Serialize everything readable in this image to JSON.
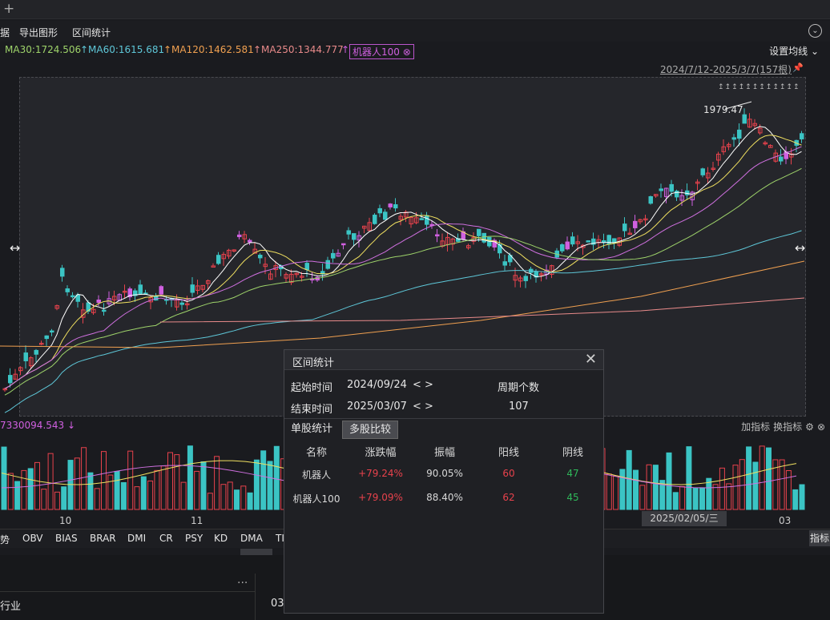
{
  "menu": {
    "items": [
      "据",
      "导出图形",
      "区间统计"
    ],
    "settings_icon": "circle-chevron-down-icon"
  },
  "ma": {
    "ma30": "MA30:1724.506",
    "ma60": "MA60:1615.681",
    "ma120": "MA120:1462.581",
    "ma250": "MA250:1344.777",
    "tag": "机器人100"
  },
  "setma": "设置均线",
  "range": "2024/7/12-2025/3/7(157根)",
  "peak": "1979.47",
  "vol": {
    "header": "7330094.543 ↓",
    "addind": "加指标",
    "swapind": "换指标"
  },
  "xlabels": [
    "10",
    "11",
    "03"
  ],
  "datebox": "2025/02/05/三",
  "indicators": [
    "势",
    "OBV",
    "BIAS",
    "BRAR",
    "DMI",
    "CR",
    "PSY",
    "KD",
    "DMA",
    "TI"
  ],
  "zhibtn": "指标",
  "bottom": {
    "dots": "···",
    "industry": "行业",
    "col": "03"
  },
  "colors": {
    "up": "#e8424c",
    "down": "#3bc4c4",
    "purple": "#d060e0"
  },
  "dialog": {
    "title": "区间统计",
    "start_label": "起始时间",
    "start": "2024/09/24",
    "end_label": "结束时间",
    "end": "2025/03/07",
    "nav": "< >",
    "count_label": "周期个数",
    "count": "107",
    "tab1": "单股统计",
    "tab2": "多股比较",
    "headers": [
      "名称",
      "涨跌幅",
      "振幅",
      "阳线",
      "阴线"
    ],
    "rows": [
      [
        "机器人",
        "+79.24%",
        "90.05%",
        "60",
        "47"
      ],
      [
        "机器人100",
        "+79.09%",
        "88.40%",
        "62",
        "45"
      ]
    ]
  },
  "chart_data": {
    "type": "candlestick",
    "range": "2024/7/12-2025/3/7(157根)",
    "peak": 1979.47,
    "ma": {
      "MA30": 1724.506,
      "MA60": 1615.681,
      "MA120": 1462.581,
      "MA250": 1344.777
    }
  }
}
